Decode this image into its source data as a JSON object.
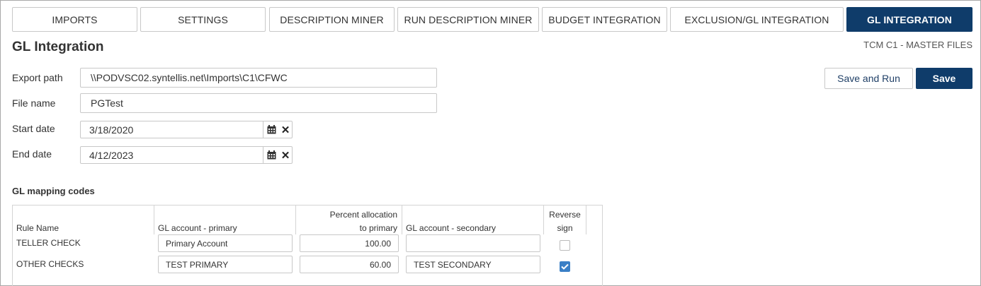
{
  "tabs": [
    {
      "label": "IMPORTS",
      "active": false
    },
    {
      "label": "SETTINGS",
      "active": false
    },
    {
      "label": "DESCRIPTION MINER",
      "active": false
    },
    {
      "label": "RUN DESCRIPTION MINER",
      "active": false
    },
    {
      "label": "BUDGET INTEGRATION",
      "active": false
    },
    {
      "label": "EXCLUSION/GL INTEGRATION",
      "active": false
    },
    {
      "label": "GL INTEGRATION",
      "active": true
    }
  ],
  "page": {
    "title": "GL Integration",
    "org_label": "TCM C1 - MASTER FILES"
  },
  "form": {
    "export_path": {
      "label": "Export path",
      "value": "\\\\PODVSC02.syntellis.net\\Imports\\C1\\CFWC"
    },
    "file_name": {
      "label": "File name",
      "value": "PGTest"
    },
    "start_date": {
      "label": "Start date",
      "value": "3/18/2020"
    },
    "end_date": {
      "label": "End date",
      "value": "4/12/2023"
    }
  },
  "actions": {
    "save_and_run": "Save and Run",
    "save": "Save"
  },
  "mapping": {
    "section_title": "GL mapping codes",
    "headers": {
      "rule_name": "Rule Name",
      "primary": "GL account - primary",
      "percent_line1": "Percent allocation",
      "percent_line2": "to primary",
      "secondary": "GL account - secondary",
      "reverse_line1": "Reverse",
      "reverse_line2": "sign"
    },
    "rows": [
      {
        "rule": "TELLER CHECK",
        "primary": "Primary Account",
        "percent": "100.00",
        "secondary": "",
        "reverse": false
      },
      {
        "rule": "OTHER CHECKS",
        "primary": "TEST PRIMARY",
        "percent": "60.00",
        "secondary": "TEST SECONDARY",
        "reverse": true
      }
    ]
  },
  "colors": {
    "accent": "#0f3c6a",
    "checkbox_on": "#3a7fc6"
  }
}
